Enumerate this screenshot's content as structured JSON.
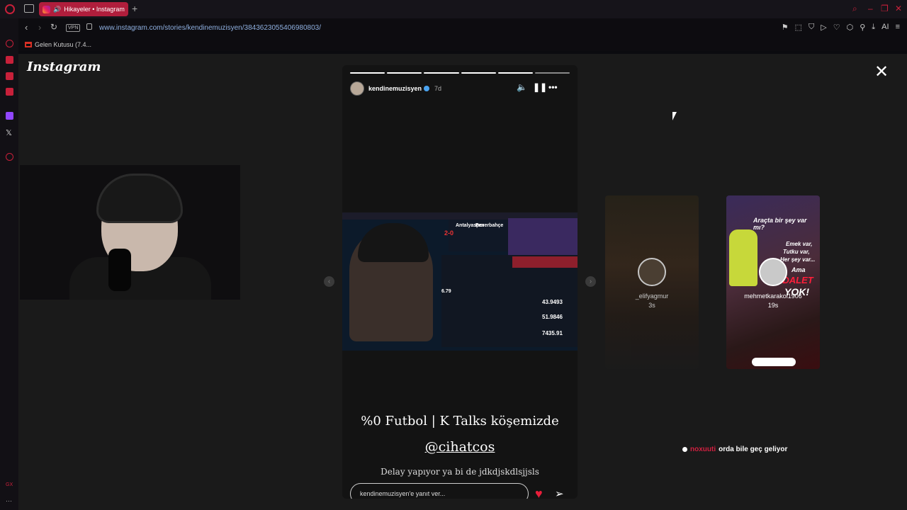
{
  "browser": {
    "tab_title": "Hikayeler • Instagram",
    "url": "www.instagram.com/stories/kendinemuzisyen/3843623055406980803/",
    "vpn_label": "VPN",
    "bookmark_label": "Gelen Kutusu (7.4...",
    "ai_label": "AI"
  },
  "instagram": {
    "logo_text": "Instagram"
  },
  "story": {
    "username": "kendinemuzisyen",
    "time_ago": "7d",
    "segments_done": 5,
    "segments_total": 6,
    "caption": "%0 Futbol | K Talks köşemizde",
    "mention": "@cihatcos",
    "subcaption": "Delay yapıyor ya bi de jdkdjskdlsjjsls",
    "reply_placeholder": "kendinemuzisyen'e yanıt ver...",
    "media": {
      "team1": "Antalyaspor",
      "team2": "Fenerbahçe",
      "score": "2-0",
      "rating": "6.79",
      "values": [
        "43.9493",
        "51.9846",
        "7435.91"
      ]
    }
  },
  "next_stories": [
    {
      "username": "_elifyagmur",
      "time": "3s"
    },
    {
      "username": "mehmetkarakol1906",
      "time": "19s",
      "overlay_lines": [
        "Araçta bir şey var mı?",
        "Emek var,",
        "Tutku var,",
        "Her şey var...",
        "Ama",
        "ADALET",
        "YOK!"
      ]
    }
  ],
  "chat": {
    "user": "noxuuti",
    "message": "orda bile geç geliyor"
  },
  "colors": {
    "accent": "#b01e3c",
    "heart": "#e91e3a",
    "verified": "#4aa3f0"
  }
}
